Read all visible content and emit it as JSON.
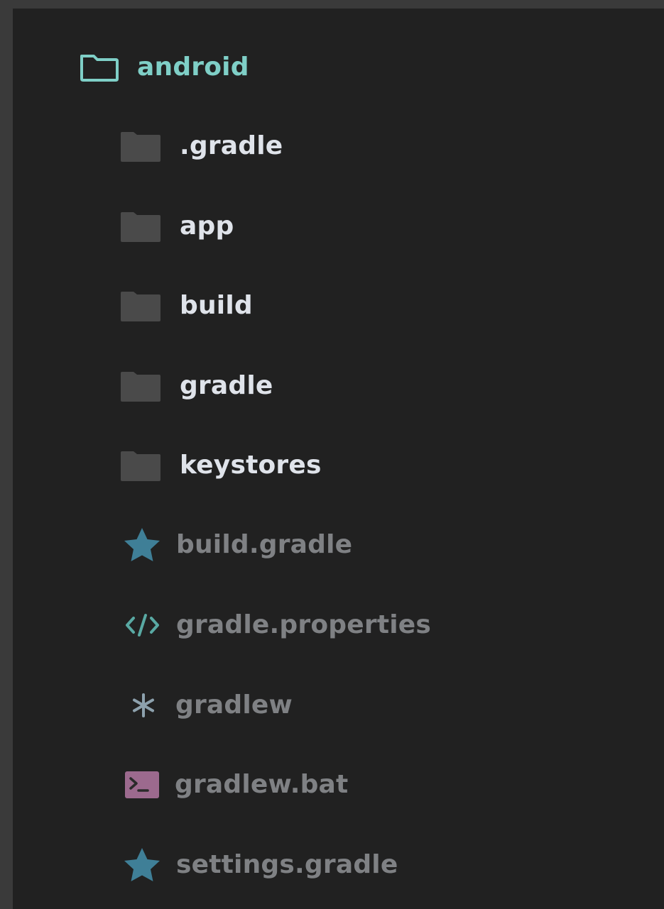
{
  "tree": {
    "root": {
      "label": "android",
      "icon": "folder-open-icon"
    },
    "folders": [
      {
        "label": ".gradle",
        "icon": "folder-icon"
      },
      {
        "label": "app",
        "icon": "folder-icon"
      },
      {
        "label": "build",
        "icon": "folder-icon"
      },
      {
        "label": "gradle",
        "icon": "folder-icon"
      },
      {
        "label": "keystores",
        "icon": "folder-icon"
      }
    ],
    "files": [
      {
        "label": "build.gradle",
        "icon": "star-icon"
      },
      {
        "label": "gradle.properties",
        "icon": "code-icon"
      },
      {
        "label": "gradlew",
        "icon": "asterisk-icon"
      },
      {
        "label": "gradlew.bat",
        "icon": "terminal-icon"
      },
      {
        "label": "settings.gradle",
        "icon": "star-icon"
      }
    ]
  },
  "colors": {
    "background": "#212121",
    "frame": "#3a3a3a",
    "root_accent": "#7fcfc7",
    "folder_icon": "#4a4a4a",
    "folder_label": "#dfe3ea",
    "file_label": "#7f8184",
    "star_icon": "#3f7f97",
    "code_icon": "#59a9a3",
    "asterisk_icon": "#8da1ad",
    "terminal_icon": "#9c6a8e"
  }
}
